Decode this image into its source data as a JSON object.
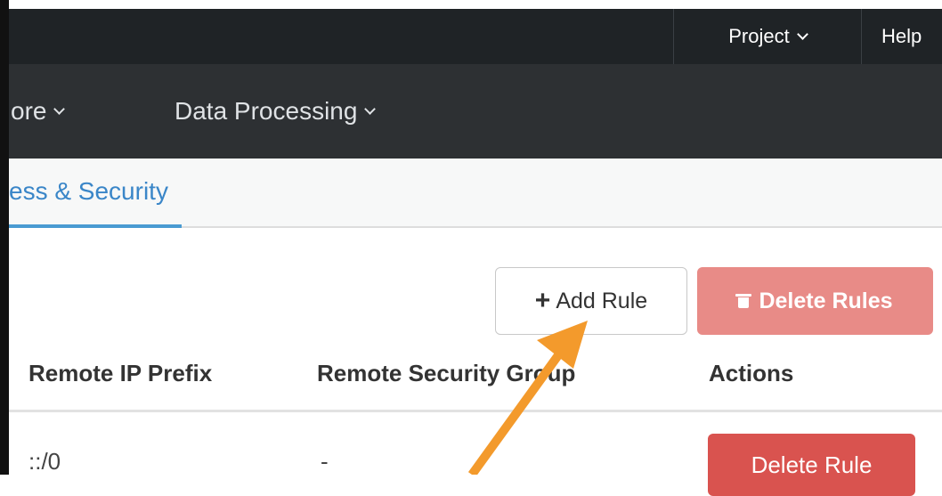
{
  "topbar": {
    "project_label": "Project",
    "help_label": "Help"
  },
  "nav": {
    "store_label": "ore",
    "data_processing_label": "Data Processing"
  },
  "tabs": {
    "active_label": "ess & Security"
  },
  "actions": {
    "add_rule_label": "Add Rule",
    "delete_rules_label": "Delete Rules"
  },
  "table": {
    "columns": [
      "Remote IP Prefix",
      "Remote Security Group",
      "Actions"
    ],
    "rows": [
      {
        "remote_ip_prefix": "::/0",
        "remote_security_group": "-",
        "action_label": "Delete Rule"
      }
    ]
  },
  "colors": {
    "accent": "#3a86c8",
    "danger": "#d9534f",
    "danger_disabled": "#e88b87",
    "annotation_arrow": "#f39a2c"
  }
}
